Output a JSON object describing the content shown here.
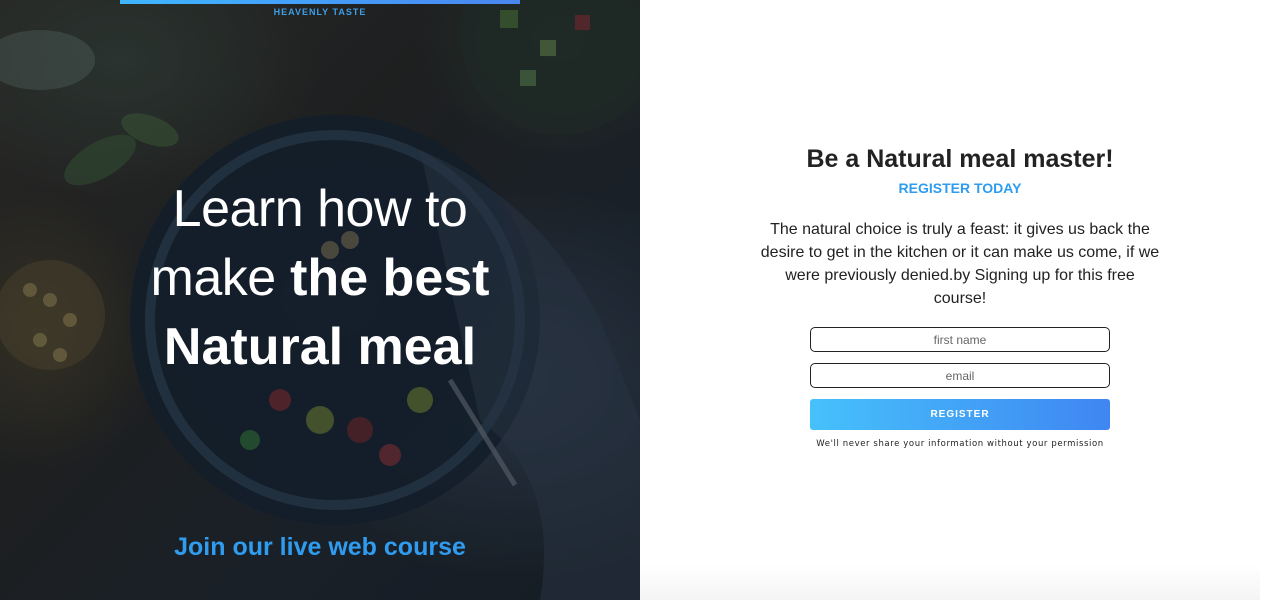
{
  "hero": {
    "brand": "HEAVENLY TASTE",
    "headline": {
      "line1": "Learn how to",
      "line2_light": "make",
      "line2_bold": "the best",
      "line3": "Natural meal"
    },
    "cta": "Join our live web course"
  },
  "form": {
    "title": "Be a Natural meal master!",
    "subtitle": "REGISTER TODAY",
    "description": "The natural choice is truly a feast: it gives us back the desire to get in the kitchen or it can make us come, if we were previously denied.by Signing up for this free course!",
    "first_name_placeholder": "first name",
    "email_placeholder": "email",
    "register_label": "REGISTER",
    "privacy_note": "We'll never share your information without your permission"
  },
  "colors": {
    "accent": "#2f9cef",
    "button_gradient_start": "#46c1fb",
    "button_gradient_end": "#3f86f2",
    "text_dark": "#222222"
  },
  "icons": {
    "hero_image": "food-photo-background"
  }
}
